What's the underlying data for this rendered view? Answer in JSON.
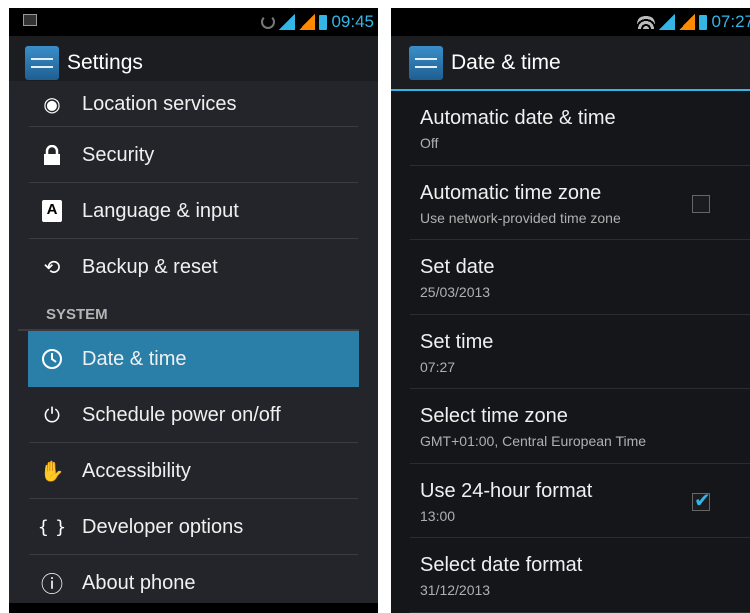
{
  "left_screen": {
    "status_bar": {
      "time": "09:45",
      "icons": [
        "picture-notification-icon",
        "sync-icon",
        "signal-icon",
        "signal-roaming-icon",
        "battery-icon"
      ]
    },
    "action_bar": {
      "title": "Settings",
      "icon": "settings-app-icon"
    },
    "items_before": [
      {
        "label": "Location services",
        "icon": "location-icon",
        "glyph": "◉"
      },
      {
        "label": "Security",
        "icon": "lock-icon",
        "glyph": "🔒"
      },
      {
        "label": "Language & input",
        "icon": "keyboard-icon",
        "glyph": "A"
      },
      {
        "label": "Backup & reset",
        "icon": "backup-icon",
        "glyph": "⟲"
      }
    ],
    "section_header": "SYSTEM",
    "selected_item": {
      "label": "Date & time",
      "icon": "clock-icon",
      "glyph": "◷"
    },
    "items_after": [
      {
        "label": "Schedule power on/off",
        "icon": "power-schedule-icon",
        "glyph": "⏻"
      },
      {
        "label": "Accessibility",
        "icon": "hand-icon",
        "glyph": "✋"
      },
      {
        "label": "Developer options",
        "icon": "braces-icon",
        "glyph": "{ }"
      },
      {
        "label": "About phone",
        "icon": "info-icon",
        "glyph": "ⓘ"
      }
    ]
  },
  "right_screen": {
    "status_bar": {
      "time": "07:27",
      "icons": [
        "wifi-icon",
        "signal-icon",
        "signal-orange-icon",
        "battery-icon"
      ]
    },
    "action_bar": {
      "title": "Date & time",
      "icon": "settings-app-icon"
    },
    "items": [
      {
        "title": "Automatic date & time",
        "subtitle": "Off",
        "checkbox": null
      },
      {
        "title": "Automatic time zone",
        "subtitle": "Use network-provided time zone",
        "checkbox": "unchecked"
      },
      {
        "title": "Set date",
        "subtitle": "25/03/2013",
        "checkbox": null
      },
      {
        "title": "Set time",
        "subtitle": "07:27",
        "checkbox": null
      },
      {
        "title": "Select time zone",
        "subtitle": "GMT+01:00, Central European Time",
        "checkbox": null
      },
      {
        "title": "Use 24-hour format",
        "subtitle": "13:00",
        "checkbox": "checked"
      },
      {
        "title": "Select date format",
        "subtitle": "31/12/2013",
        "checkbox": null
      }
    ]
  },
  "colors": {
    "accent": "#33b5e5",
    "selected": "#2a7fa8",
    "background": "#23252a"
  }
}
